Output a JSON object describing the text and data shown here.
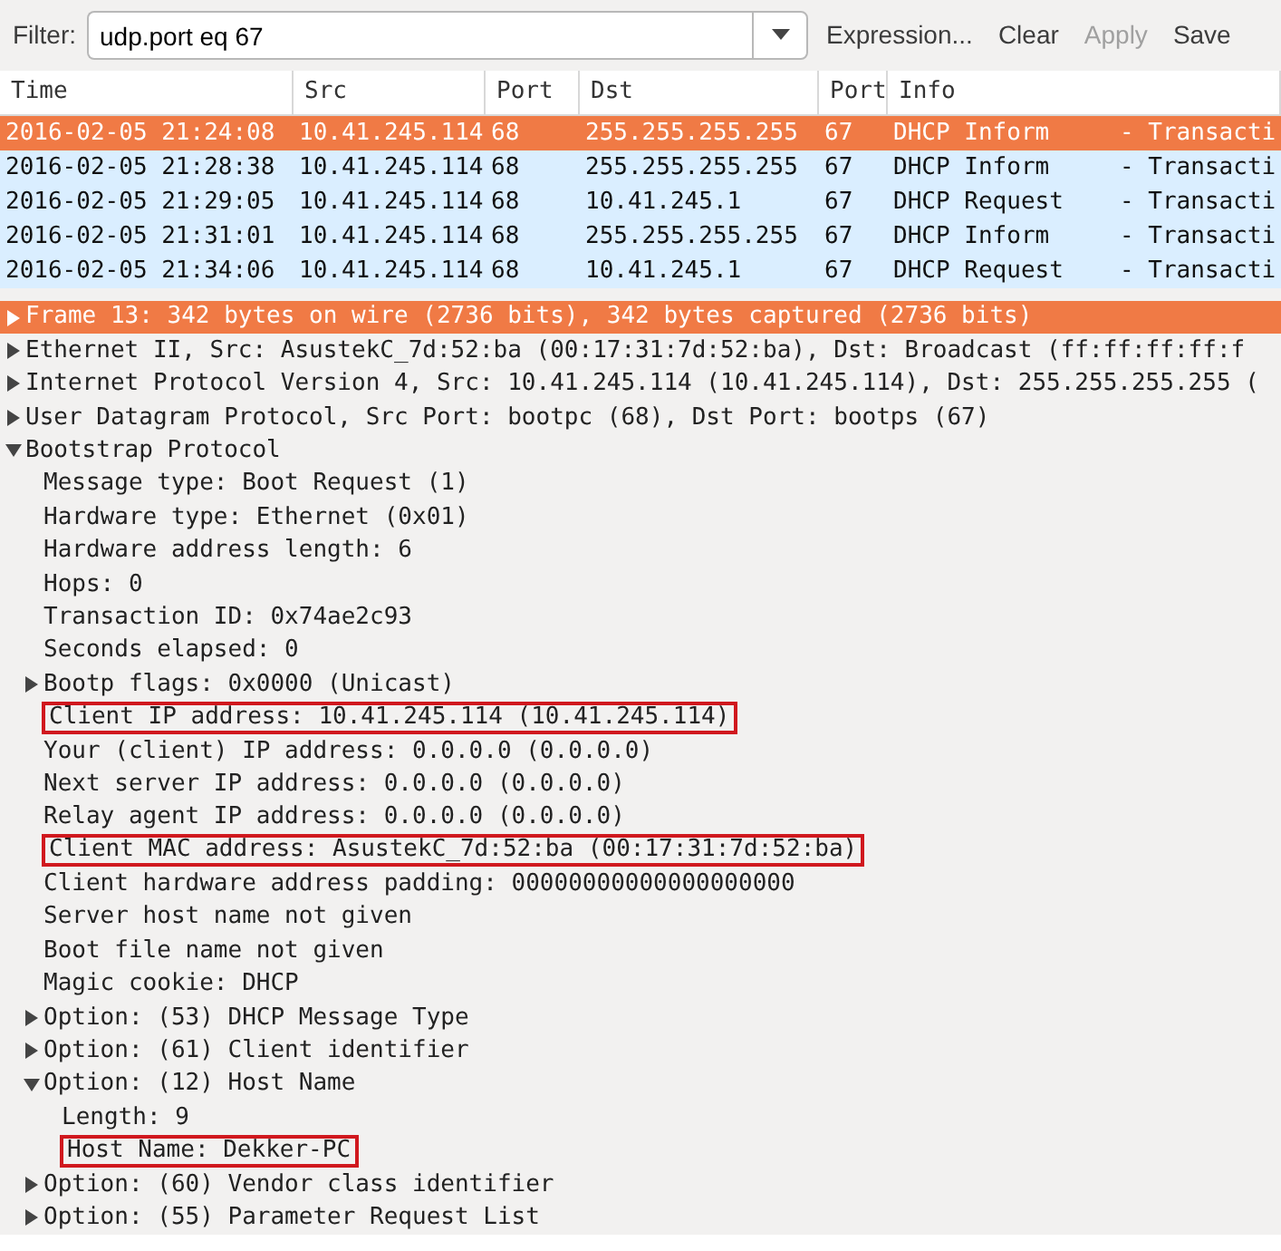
{
  "filter": {
    "label": "Filter:",
    "value": "udp.port eq 67"
  },
  "filter_buttons": [
    {
      "label": "Expression...",
      "disabled": false
    },
    {
      "label": "Clear",
      "disabled": false
    },
    {
      "label": "Apply",
      "disabled": true
    },
    {
      "label": "Save",
      "disabled": false
    }
  ],
  "packet_list": {
    "columns": [
      "Time",
      "Src",
      "Port",
      "Dst",
      "Port",
      "Info"
    ],
    "rows": [
      {
        "selected": true,
        "cells": [
          "2016-02-05 21:24:08",
          "10.41.245.114",
          "68",
          "255.255.255.255",
          "67",
          "DHCP Inform"
        ],
        "info_detail": "- Transacti"
      },
      {
        "selected": false,
        "cells": [
          "2016-02-05 21:28:38",
          "10.41.245.114",
          "68",
          "255.255.255.255",
          "67",
          "DHCP Inform"
        ],
        "info_detail": "- Transacti"
      },
      {
        "selected": false,
        "cells": [
          "2016-02-05 21:29:05",
          "10.41.245.114",
          "68",
          "10.41.245.1",
          "67",
          "DHCP Request"
        ],
        "info_detail": "- Transacti"
      },
      {
        "selected": false,
        "cells": [
          "2016-02-05 21:31:01",
          "10.41.245.114",
          "68",
          "255.255.255.255",
          "67",
          "DHCP Inform"
        ],
        "info_detail": "- Transacti"
      },
      {
        "selected": false,
        "cells": [
          "2016-02-05 21:34:06",
          "10.41.245.114",
          "68",
          "10.41.245.1",
          "67",
          "DHCP Request"
        ],
        "info_detail": "- Transacti"
      }
    ]
  },
  "detail_tree": [
    {
      "text": "Frame 13: 342 bytes on wire (2736 bits), 342 bytes captured (2736 bits)",
      "kind": "branch",
      "expanded": false,
      "selected": true,
      "highlighted": false
    },
    {
      "text": "Ethernet II, Src: AsustekC_7d:52:ba (00:17:31:7d:52:ba), Dst: Broadcast (ff:ff:ff:ff:f",
      "kind": "branch",
      "expanded": false,
      "selected": false,
      "highlighted": false
    },
    {
      "text": "Internet Protocol Version 4, Src: 10.41.245.114 (10.41.245.114), Dst: 255.255.255.255 (",
      "kind": "branch",
      "expanded": false,
      "selected": false,
      "highlighted": false
    },
    {
      "text": "User Datagram Protocol, Src Port: bootpc (68), Dst Port: bootps (67)",
      "kind": "branch",
      "expanded": false,
      "selected": false,
      "highlighted": false
    },
    {
      "text": "Bootstrap Protocol",
      "kind": "branch",
      "expanded": true,
      "selected": false,
      "highlighted": false,
      "children": [
        {
          "text": "Message type: Boot Request (1)",
          "kind": "leaf",
          "selected": false,
          "highlighted": false
        },
        {
          "text": "Hardware type: Ethernet (0x01)",
          "kind": "leaf",
          "selected": false,
          "highlighted": false
        },
        {
          "text": "Hardware address length: 6",
          "kind": "leaf",
          "selected": false,
          "highlighted": false
        },
        {
          "text": "Hops: 0",
          "kind": "leaf",
          "selected": false,
          "highlighted": false
        },
        {
          "text": "Transaction ID: 0x74ae2c93",
          "kind": "leaf",
          "selected": false,
          "highlighted": false
        },
        {
          "text": "Seconds elapsed: 0",
          "kind": "leaf",
          "selected": false,
          "highlighted": false
        },
        {
          "text": "Bootp flags: 0x0000 (Unicast)",
          "kind": "branch",
          "expanded": false,
          "selected": false,
          "highlighted": false
        },
        {
          "text": "Client IP address: 10.41.245.114 (10.41.245.114)",
          "kind": "leaf",
          "selected": false,
          "highlighted": true
        },
        {
          "text": "Your (client) IP address: 0.0.0.0 (0.0.0.0)",
          "kind": "leaf",
          "selected": false,
          "highlighted": false
        },
        {
          "text": "Next server IP address: 0.0.0.0 (0.0.0.0)",
          "kind": "leaf",
          "selected": false,
          "highlighted": false
        },
        {
          "text": "Relay agent IP address: 0.0.0.0 (0.0.0.0)",
          "kind": "leaf",
          "selected": false,
          "highlighted": false
        },
        {
          "text": "Client MAC address: AsustekC_7d:52:ba (00:17:31:7d:52:ba)",
          "kind": "leaf",
          "selected": false,
          "highlighted": true
        },
        {
          "text": "Client hardware address padding: 00000000000000000000",
          "kind": "leaf",
          "selected": false,
          "highlighted": false
        },
        {
          "text": "Server host name not given",
          "kind": "leaf",
          "selected": false,
          "highlighted": false
        },
        {
          "text": "Boot file name not given",
          "kind": "leaf",
          "selected": false,
          "highlighted": false
        },
        {
          "text": "Magic cookie: DHCP",
          "kind": "leaf",
          "selected": false,
          "highlighted": false
        },
        {
          "text": "Option: (53) DHCP Message Type",
          "kind": "branch",
          "expanded": false,
          "selected": false,
          "highlighted": false
        },
        {
          "text": "Option: (61) Client identifier",
          "kind": "branch",
          "expanded": false,
          "selected": false,
          "highlighted": false
        },
        {
          "text": "Option: (12) Host Name",
          "kind": "branch",
          "expanded": true,
          "selected": false,
          "highlighted": false,
          "children": [
            {
              "text": "Length: 9",
              "kind": "leaf",
              "selected": false,
              "highlighted": false
            },
            {
              "text": "Host Name: Dekker-PC",
              "kind": "leaf",
              "selected": false,
              "highlighted": true
            }
          ]
        },
        {
          "text": "Option: (60) Vendor class identifier",
          "kind": "branch",
          "expanded": false,
          "selected": false,
          "highlighted": false
        },
        {
          "text": "Option: (55) Parameter Request List",
          "kind": "branch",
          "expanded": false,
          "selected": false,
          "highlighted": false
        }
      ]
    }
  ]
}
